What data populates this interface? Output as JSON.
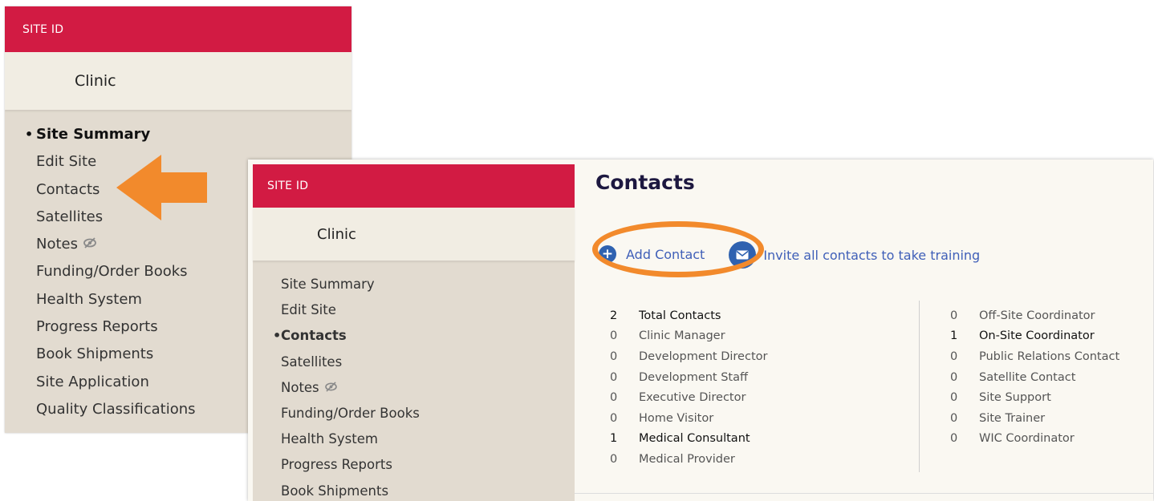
{
  "back_panel": {
    "site_id_label": "SITE ID",
    "clinic_name": "Clinic",
    "nav": [
      {
        "label": "Site Summary",
        "active": true
      },
      {
        "label": "Edit Site"
      },
      {
        "label": "Contacts"
      },
      {
        "label": "Satellites"
      },
      {
        "label": "Notes",
        "icon": "eye-slash-icon"
      },
      {
        "label": "Funding/Order Books"
      },
      {
        "label": "Health System"
      },
      {
        "label": "Progress Reports"
      },
      {
        "label": "Book Shipments"
      },
      {
        "label": "Site Application"
      },
      {
        "label": "Quality Classifications"
      }
    ]
  },
  "front_panel": {
    "site_id_label": "SITE ID",
    "clinic_name": "Clinic",
    "nav": [
      {
        "label": "Site Summary"
      },
      {
        "label": "Edit Site"
      },
      {
        "label": "Contacts",
        "active": true
      },
      {
        "label": "Satellites"
      },
      {
        "label": "Notes",
        "icon": "eye-slash-icon"
      },
      {
        "label": "Funding/Order Books"
      },
      {
        "label": "Health System"
      },
      {
        "label": "Progress Reports"
      },
      {
        "label": "Book Shipments"
      }
    ],
    "main": {
      "title": "Contacts",
      "add_contact_label": "Add Contact",
      "invite_label": "Invite all contacts to take training",
      "stats_left": [
        {
          "count": "2",
          "label": "Total Contacts",
          "emph": true
        },
        {
          "count": "0",
          "label": "Clinic Manager"
        },
        {
          "count": "0",
          "label": "Development Director"
        },
        {
          "count": "0",
          "label": "Development Staff"
        },
        {
          "count": "0",
          "label": "Executive Director"
        },
        {
          "count": "0",
          "label": "Home Visitor"
        },
        {
          "count": "1",
          "label": "Medical Consultant",
          "emph": true
        },
        {
          "count": "0",
          "label": "Medical Provider"
        }
      ],
      "stats_right": [
        {
          "count": "0",
          "label": "Off-Site Coordinator"
        },
        {
          "count": "1",
          "label": "On-Site Coordinator",
          "emph": true
        },
        {
          "count": "0",
          "label": "Public Relations Contact"
        },
        {
          "count": "0",
          "label": "Satellite Contact"
        },
        {
          "count": "0",
          "label": "Site Support"
        },
        {
          "count": "0",
          "label": "Site Trainer"
        },
        {
          "count": "0",
          "label": "WIC Coordinator"
        }
      ]
    }
  },
  "colors": {
    "brand_red": "#d21b43",
    "highlight_orange": "#f28a2c",
    "link_blue": "#3f5fb8",
    "icon_blue": "#2f62b0"
  }
}
